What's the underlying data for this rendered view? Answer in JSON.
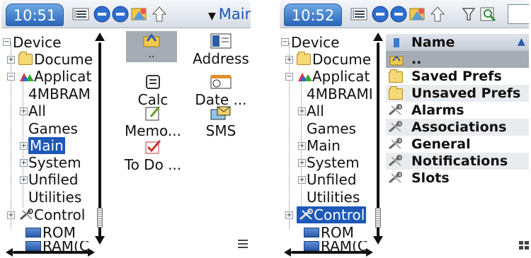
{
  "left": {
    "time": "10:51",
    "view_dropdown": "Main",
    "tree": [
      {
        "label": "Device",
        "expander": "minus",
        "icon": "none"
      },
      {
        "label": "Docume",
        "expander": "plus",
        "icon": "folder-icon"
      },
      {
        "label": "Applicat",
        "expander": "minus",
        "icon": "apps-icon"
      },
      {
        "label": "4MBRAM",
        "expander": "none",
        "icon": "none"
      },
      {
        "label": "All",
        "expander": "plus",
        "icon": "none"
      },
      {
        "label": "Games",
        "expander": "none",
        "icon": "none"
      },
      {
        "label": "Main",
        "expander": "plus",
        "icon": "none",
        "selected": true
      },
      {
        "label": "System",
        "expander": "plus",
        "icon": "none"
      },
      {
        "label": "Unfiled",
        "expander": "plus",
        "icon": "none"
      },
      {
        "label": "Utilities",
        "expander": "none",
        "icon": "none"
      },
      {
        "label": "Control",
        "expander": "plus",
        "icon": "wrench-icon"
      },
      {
        "label": "ROM",
        "expander": "none",
        "icon": "memory-icon"
      },
      {
        "label": "RAM(C",
        "expander": "none",
        "icon": "memory-icon"
      }
    ],
    "apps": [
      {
        "label": "..",
        "icon": "up-folder-icon",
        "selected": true
      },
      {
        "label": "Address",
        "icon": "address-icon"
      },
      {
        "label": "Calc",
        "icon": "calc-icon"
      },
      {
        "label": "Date ...",
        "icon": "date-icon"
      },
      {
        "label": "Memo...",
        "icon": "memo-icon"
      },
      {
        "label": "SMS",
        "icon": "sms-icon"
      },
      {
        "label": "To Do ...",
        "icon": "todo-icon"
      }
    ]
  },
  "right": {
    "time": "10:52",
    "tree": [
      {
        "label": "Device",
        "expander": "minus"
      },
      {
        "label": "Docume",
        "expander": "plus"
      },
      {
        "label": "Applicat",
        "expander": "minus"
      },
      {
        "label": "4MBRAMI",
        "expander": "none"
      },
      {
        "label": "All",
        "expander": "plus"
      },
      {
        "label": "Games",
        "expander": "none"
      },
      {
        "label": "Main",
        "expander": "plus"
      },
      {
        "label": "System",
        "expander": "plus"
      },
      {
        "label": "Unfiled",
        "expander": "plus"
      },
      {
        "label": "Utilities",
        "expander": "none"
      },
      {
        "label": "Control",
        "expander": "plus",
        "selected": true
      },
      {
        "label": "ROM",
        "expander": "none"
      },
      {
        "label": "RAM(C",
        "expander": "none"
      }
    ],
    "list_header": "Name",
    "list": [
      {
        "label": "..",
        "icon": "up-folder-icon"
      },
      {
        "label": "Saved Prefs",
        "icon": "folder-icon"
      },
      {
        "label": "Unsaved Prefs",
        "icon": "folder-icon"
      },
      {
        "label": "Alarms",
        "icon": "wrench-icon"
      },
      {
        "label": "Associations",
        "icon": "wrench-icon"
      },
      {
        "label": "General",
        "icon": "wrench-icon"
      },
      {
        "label": "Notifications",
        "icon": "wrench-icon"
      },
      {
        "label": "Slots",
        "icon": "wrench-icon"
      }
    ]
  },
  "colors": {
    "selection": "#1e58b8",
    "titlebar": "#2b66b9",
    "dropdown_text": "#1a57b2"
  }
}
